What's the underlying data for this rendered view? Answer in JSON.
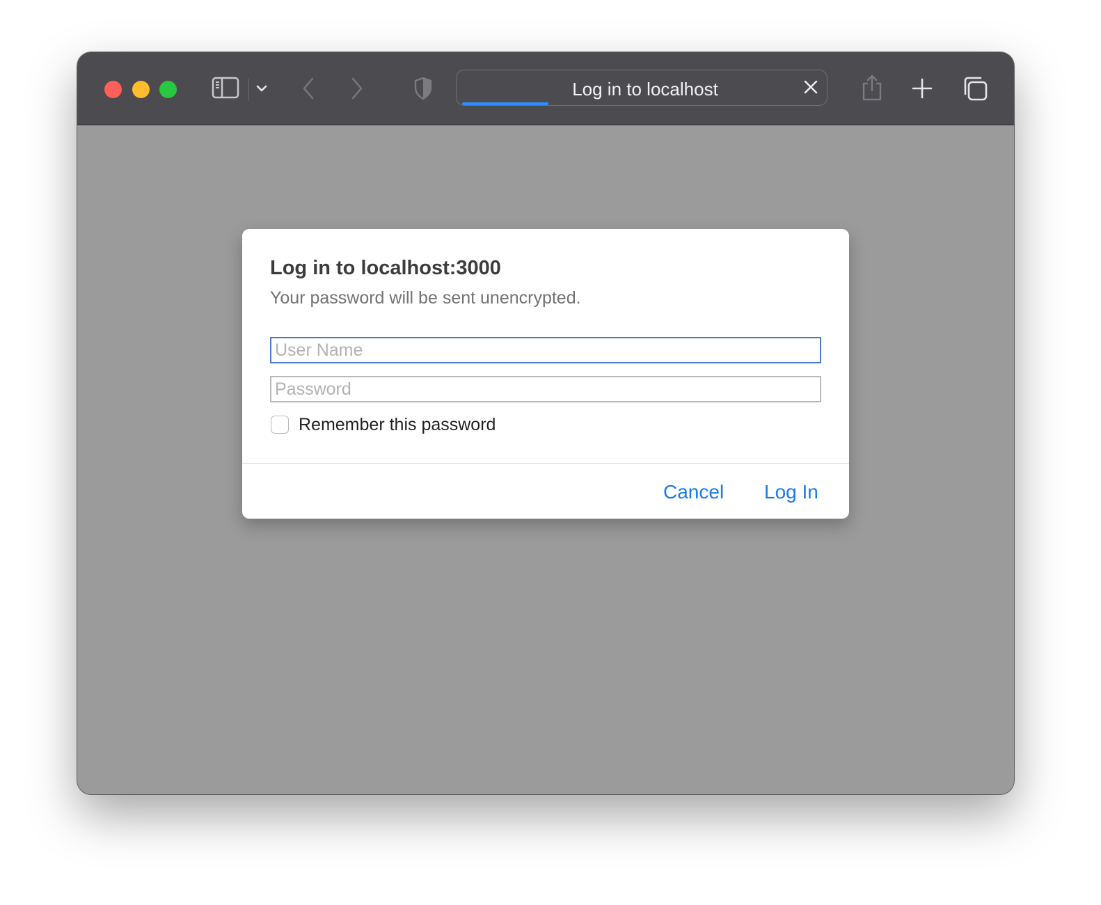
{
  "browser": {
    "tab_title": "Log in to localhost",
    "loading_progress": 0.24,
    "toolbar_icons": [
      "sidebar-icon",
      "chevron-down-icon",
      "back-icon",
      "forward-icon",
      "privacy-shield-icon",
      "close-icon",
      "share-icon",
      "plus-icon",
      "tabs-overview-icon"
    ]
  },
  "dialog": {
    "title": "Log in to localhost:3000",
    "subtitle": "Your password will be sent unencrypted.",
    "username": {
      "placeholder": "User Name",
      "value": ""
    },
    "password": {
      "placeholder": "Password",
      "value": ""
    },
    "remember_label": "Remember this password",
    "remember_checked": false,
    "cancel_label": "Cancel",
    "login_label": "Log In"
  },
  "colors": {
    "toolbar": "#4c4b50",
    "content_background": "#9b9b9b",
    "accent": "#1a7ae8",
    "focus_ring": "#4a78d6",
    "progress": "#2f8dff"
  }
}
